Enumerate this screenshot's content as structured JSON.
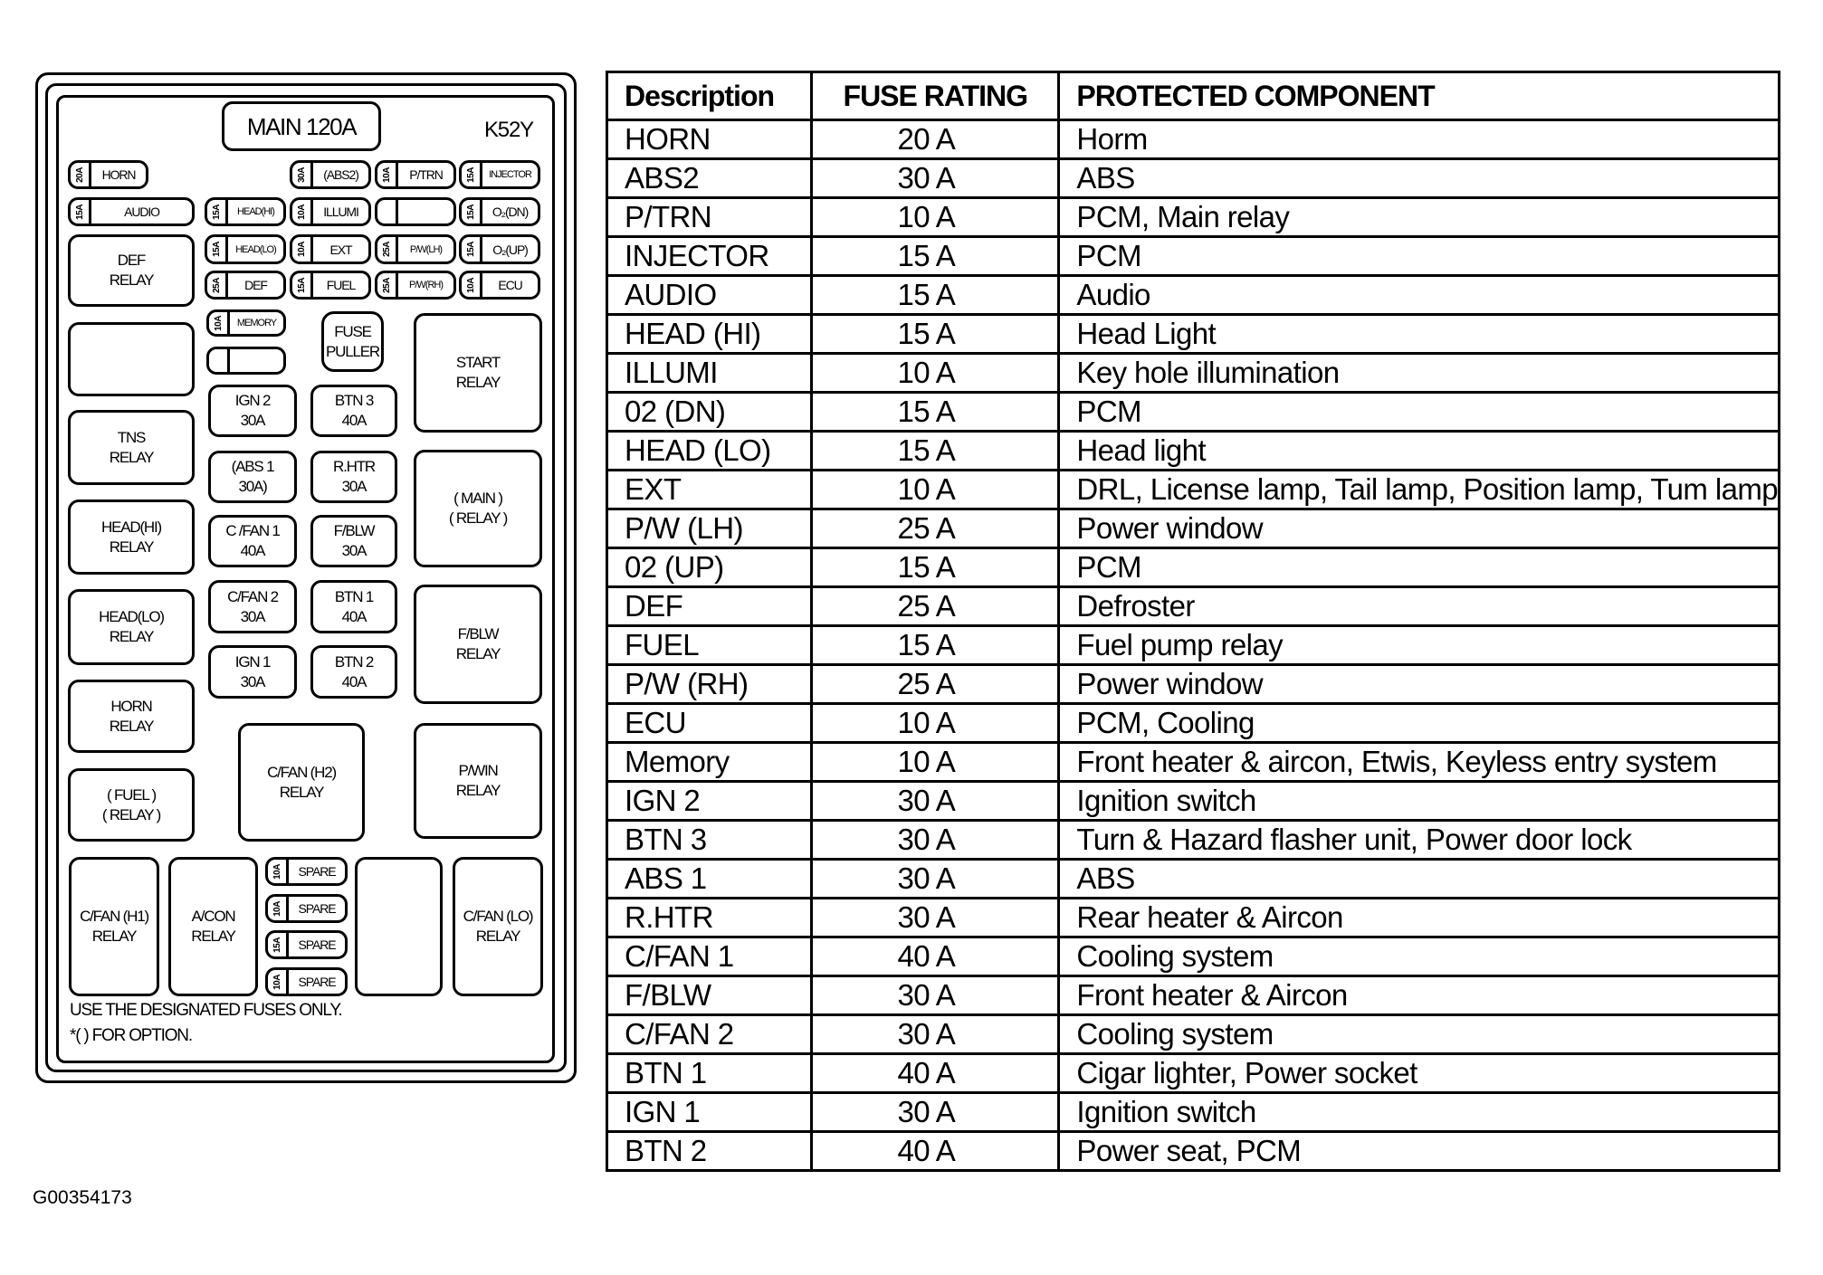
{
  "diagram": {
    "main_fuse": "MAIN 120A",
    "code": "K52Y",
    "small_fuses": [
      {
        "id": "horn",
        "label": "HORN",
        "rating": "20A"
      },
      {
        "id": "abs2",
        "label": "(ABS2)",
        "rating": "30A"
      },
      {
        "id": "ptrn",
        "label": "P/TRN",
        "rating": "10A"
      },
      {
        "id": "injector",
        "label": "INJECTOR",
        "rating": "15A"
      },
      {
        "id": "audio",
        "label": "AUDIO",
        "rating": "15A"
      },
      {
        "id": "head-hi",
        "label": "HEAD(HI)",
        "rating": "15A"
      },
      {
        "id": "illumi",
        "label": "ILLUMI",
        "rating": "10A"
      },
      {
        "id": "empty-1",
        "label": "",
        "rating": ""
      },
      {
        "id": "o2-dn",
        "label": "O₂(DN)",
        "rating": "15A"
      },
      {
        "id": "head-lo",
        "label": "HEAD(LO)",
        "rating": "15A"
      },
      {
        "id": "ext",
        "label": "EXT",
        "rating": "10A"
      },
      {
        "id": "pw-lh",
        "label": "P/W(LH)",
        "rating": "25A"
      },
      {
        "id": "o2-up",
        "label": "O₂(UP)",
        "rating": "15A"
      },
      {
        "id": "def",
        "label": "DEF",
        "rating": "25A"
      },
      {
        "id": "fuel",
        "label": "FUEL",
        "rating": "15A"
      },
      {
        "id": "pw-rh",
        "label": "P/W(RH)",
        "rating": "25A"
      },
      {
        "id": "ecu",
        "label": "ECU",
        "rating": "10A"
      },
      {
        "id": "memory",
        "label": "MEMORY",
        "rating": "10A"
      },
      {
        "id": "empty-2",
        "label": "",
        "rating": ""
      },
      {
        "id": "spare-1",
        "label": "SPARE",
        "rating": "10A"
      },
      {
        "id": "spare-2",
        "label": "SPARE",
        "rating": "10A"
      },
      {
        "id": "spare-3",
        "label": "SPARE",
        "rating": "15A"
      },
      {
        "id": "spare-4",
        "label": "SPARE",
        "rating": "10A"
      }
    ],
    "fuse_puller": [
      "FUSE",
      "PULLER"
    ],
    "large_fuses": [
      {
        "name": "IGN 2",
        "rating": "30A"
      },
      {
        "name": "BTN 3",
        "rating": "40A"
      },
      {
        "name": "(ABS 1",
        "rating": "30A)"
      },
      {
        "name": "R.HTR",
        "rating": "30A"
      },
      {
        "name": "C /FAN 1",
        "rating": "40A"
      },
      {
        "name": "F/BLW",
        "rating": "30A"
      },
      {
        "name": "C/FAN 2",
        "rating": "30A"
      },
      {
        "name": "BTN 1",
        "rating": "40A"
      },
      {
        "name": "IGN 1",
        "rating": "30A"
      },
      {
        "name": "BTN 2",
        "rating": "40A"
      }
    ],
    "relays": {
      "def": [
        "DEF",
        "RELAY"
      ],
      "tns": [
        "TNS",
        "RELAY"
      ],
      "head_hi": [
        "HEAD(HI)",
        "RELAY"
      ],
      "head_lo": [
        "HEAD(LO)",
        "RELAY"
      ],
      "horn": [
        "HORN",
        "RELAY"
      ],
      "fuel": [
        "( FUEL )",
        "( RELAY )"
      ],
      "start": [
        "START",
        "RELAY"
      ],
      "main": [
        "( MAIN )",
        "( RELAY )"
      ],
      "fblw": [
        "F/BLW",
        "RELAY"
      ],
      "cfan_h2": [
        "C/FAN (H2)",
        "RELAY"
      ],
      "pwin": [
        "P/WIN",
        "RELAY"
      ],
      "cfan_h1": [
        "C/FAN (H1)",
        "RELAY"
      ],
      "acon": [
        "A/CON",
        "RELAY"
      ],
      "cfan_lo": [
        "C/FAN (LO)",
        "RELAY"
      ]
    },
    "notes": [
      "USE THE DESIGNATED FUSES ONLY.",
      "*(   ) FOR OPTION."
    ]
  },
  "table": {
    "headers": [
      "Description",
      "FUSE RATING",
      "PROTECTED COMPONENT"
    ],
    "rows": [
      [
        "HORN",
        "20 A",
        "Horm"
      ],
      [
        "ABS2",
        "30 A",
        "ABS"
      ],
      [
        "P/TRN",
        "10 A",
        "PCM, Main relay"
      ],
      [
        "INJECTOR",
        "15 A",
        "PCM"
      ],
      [
        "AUDIO",
        "15 A",
        "Audio"
      ],
      [
        "HEAD (HI)",
        "15 A",
        "Head Light"
      ],
      [
        "ILLUMI",
        "10 A",
        "Key hole illumination"
      ],
      [
        "02 (DN)",
        "15 A",
        "PCM"
      ],
      [
        "HEAD (LO)",
        "15 A",
        "Head light"
      ],
      [
        "EXT",
        "10 A",
        "DRL, License lamp, Tail lamp, Position lamp, Tum lamp"
      ],
      [
        "P/W (LH)",
        "25 A",
        "Power window"
      ],
      [
        "02 (UP)",
        "15 A",
        "PCM"
      ],
      [
        "DEF",
        "25 A",
        "Defroster"
      ],
      [
        "FUEL",
        "15 A",
        "Fuel pump relay"
      ],
      [
        "P/W (RH)",
        "25 A",
        "Power window"
      ],
      [
        "ECU",
        "10 A",
        "PCM, Cooling"
      ],
      [
        "Memory",
        "10 A",
        "Front heater & aircon, Etwis, Keyless entry system"
      ],
      [
        "IGN 2",
        "30 A",
        "Ignition switch"
      ],
      [
        "BTN 3",
        "30 A",
        "Turn & Hazard flasher unit, Power door lock"
      ],
      [
        "ABS 1",
        "30 A",
        "ABS"
      ],
      [
        "R.HTR",
        "30 A",
        "Rear heater & Aircon"
      ],
      [
        "C/FAN 1",
        "40 A",
        "Cooling system"
      ],
      [
        "F/BLW",
        "30 A",
        "Front heater & Aircon"
      ],
      [
        "C/FAN 2",
        "30 A",
        "Cooling system"
      ],
      [
        "BTN 1",
        "40 A",
        "Cigar lighter, Power socket"
      ],
      [
        "IGN 1",
        "30 A",
        "Ignition switch"
      ],
      [
        "BTN 2",
        "40 A",
        "Power seat, PCM"
      ]
    ]
  },
  "figure_id": "G00354173"
}
